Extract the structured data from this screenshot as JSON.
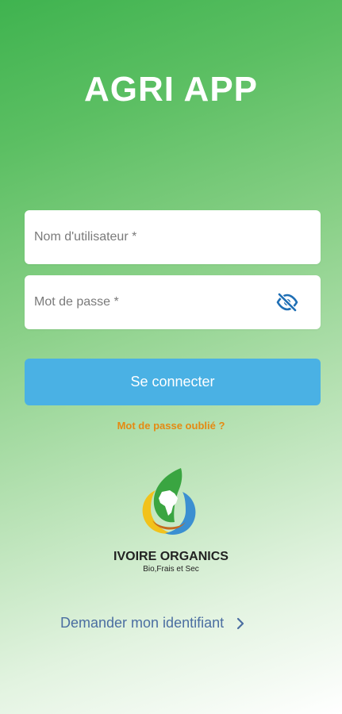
{
  "app": {
    "title": "AGRI APP"
  },
  "form": {
    "username_placeholder": "Nom d'utilisateur *",
    "username_value": "",
    "password_placeholder": "Mot de passe *",
    "password_value": "",
    "password_toggle_icon": "eye-off-icon",
    "login_label": "Se connecter",
    "forgot_label": "Mot de passe oublié ?"
  },
  "brand": {
    "name": "IVOIRE ORGANICS",
    "tagline": "Bio,Frais et Sec",
    "logo_icon": "africa-leaf-logo"
  },
  "footer": {
    "request_label": "Demander mon identifiant",
    "request_icon": "chevron-right-icon"
  },
  "colors": {
    "primary_green": "#3fb34f",
    "button_blue": "#4ab1e4",
    "link_orange": "#e58a12",
    "link_blue": "#4b6ea1",
    "eye_icon_blue": "#1f6fb5"
  }
}
